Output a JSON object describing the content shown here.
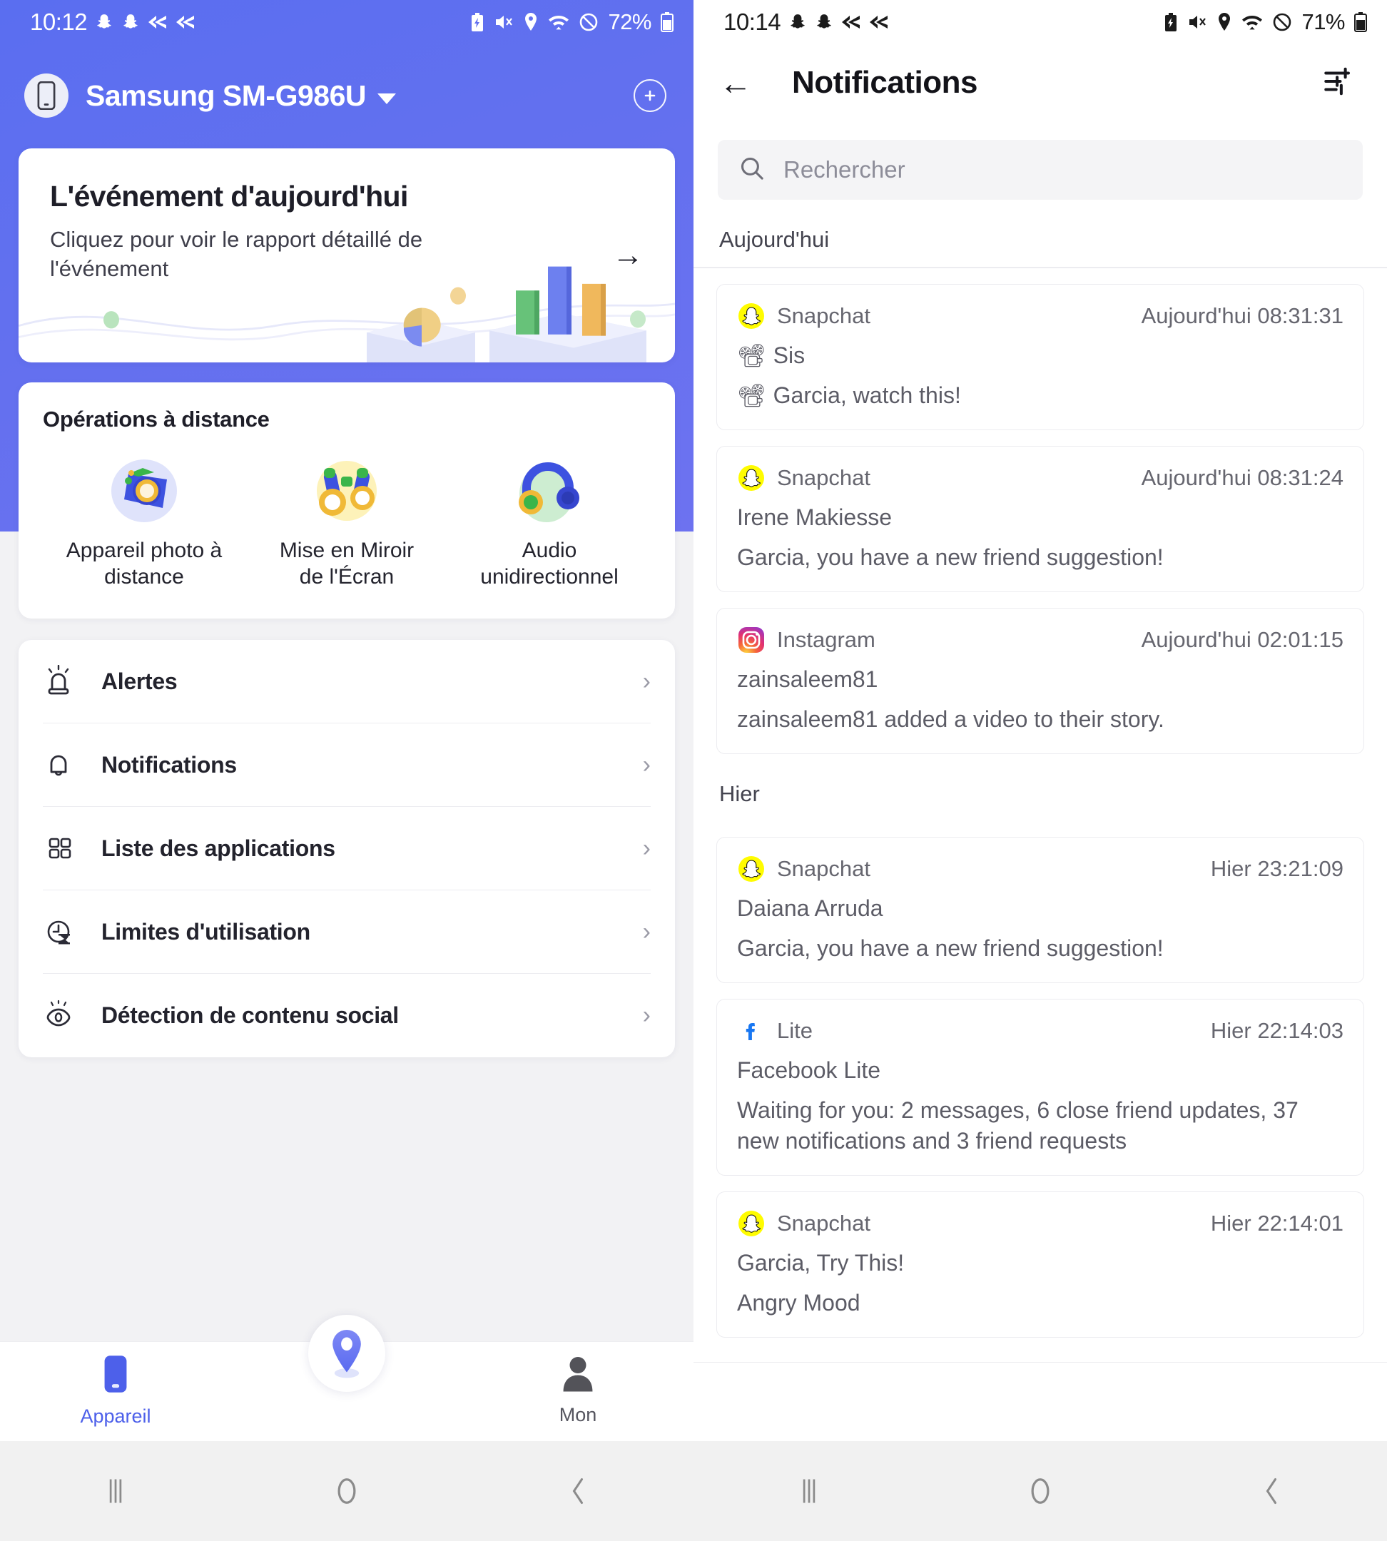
{
  "left": {
    "status": {
      "time": "10:12",
      "battery": "72%",
      "icons": [
        "snapchat-ghost",
        "snapchat-ghost",
        "rewind",
        "rewind"
      ],
      "right_icons": [
        "battery-saver",
        "mute",
        "location",
        "wifi",
        "dnd"
      ]
    },
    "device": {
      "name": "Samsung SM-G986U",
      "dropdown": "▾",
      "add_label": "+"
    },
    "event_card": {
      "title": "L'événement d'aujourd'hui",
      "subtitle": "Cliquez pour voir le rapport détaillé de l'événement",
      "arrow": "→"
    },
    "remote": {
      "title": "Opérations à distance",
      "items": [
        {
          "label": "Appareil photo à distance",
          "icon": "camera-icon"
        },
        {
          "label": "Mise en Miroir de l'Écran",
          "icon": "binoculars-icon"
        },
        {
          "label": "Audio unidirectionnel",
          "icon": "headphones-icon"
        }
      ]
    },
    "menu": [
      {
        "label": "Alertes",
        "icon": "siren-icon",
        "chevron": "›"
      },
      {
        "label": "Notifications",
        "icon": "bell-icon",
        "chevron": "›"
      },
      {
        "label": "Liste des applications",
        "icon": "apps-grid-icon",
        "chevron": "›"
      },
      {
        "label": "Limites d'utilisation",
        "icon": "clock-hourglass-icon",
        "chevron": "›"
      },
      {
        "label": "Détection de contenu social",
        "icon": "eye-icon",
        "chevron": "›"
      }
    ],
    "tabs": [
      {
        "label": "Appareil",
        "icon": "phone-icon",
        "active": true
      },
      {
        "label": "",
        "icon": "location-pin-icon",
        "active": false
      },
      {
        "label": "Mon",
        "icon": "person-icon",
        "active": false
      }
    ],
    "accent": "#4d60ea",
    "header_bg": "#6270ef"
  },
  "right": {
    "status": {
      "time": "10:14",
      "battery": "71%"
    },
    "header": {
      "back": "←",
      "title": "Notifications",
      "filter_icon": "tune-filter-icon"
    },
    "search": {
      "placeholder": "Rechercher",
      "icon": "search-icon"
    },
    "sections": [
      {
        "label": "Aujourd'hui",
        "items": [
          {
            "app": "Snapchat",
            "icon": "snapchat-icon",
            "time": "Aujourd'hui 08:31:31",
            "lines": [
              {
                "emoji": "📽",
                "text": "Sis"
              },
              {
                "emoji": "📽",
                "text": "Garcia, watch this!"
              }
            ]
          },
          {
            "app": "Snapchat",
            "icon": "snapchat-icon",
            "time": "Aujourd'hui 08:31:24",
            "lines": [
              {
                "emoji": "",
                "text": "Irene Makiesse"
              },
              {
                "emoji": "",
                "text": "Garcia, you have a new friend suggestion!"
              }
            ]
          },
          {
            "app": "Instagram",
            "icon": "instagram-icon",
            "time": "Aujourd'hui 02:01:15",
            "lines": [
              {
                "emoji": "",
                "text": "zainsaleem81"
              },
              {
                "emoji": "",
                "text": "zainsaleem81 added a video to their story."
              }
            ]
          }
        ]
      },
      {
        "label": "Hier",
        "items": [
          {
            "app": "Snapchat",
            "icon": "snapchat-icon",
            "time": "Hier 23:21:09",
            "lines": [
              {
                "emoji": "",
                "text": "Daiana Arruda"
              },
              {
                "emoji": "",
                "text": "Garcia, you have a new friend suggestion!"
              }
            ]
          },
          {
            "app": "Lite",
            "icon": "facebook-icon",
            "time": "Hier 22:14:03",
            "lines": [
              {
                "emoji": "",
                "text": "Facebook Lite"
              },
              {
                "emoji": "",
                "text": "Waiting for you: 2 messages, 6 close friend updates, 37 new notifications and 3 friend requests"
              }
            ]
          },
          {
            "app": "Snapchat",
            "icon": "snapchat-icon",
            "time": "Hier 22:14:01",
            "lines": [
              {
                "emoji": "",
                "text": "Garcia, Try This!"
              },
              {
                "emoji": "",
                "text": "Angry Mood"
              }
            ]
          }
        ]
      }
    ]
  },
  "android_nav": {
    "recents": "recents-icon",
    "home": "home-icon",
    "back": "back-icon"
  }
}
